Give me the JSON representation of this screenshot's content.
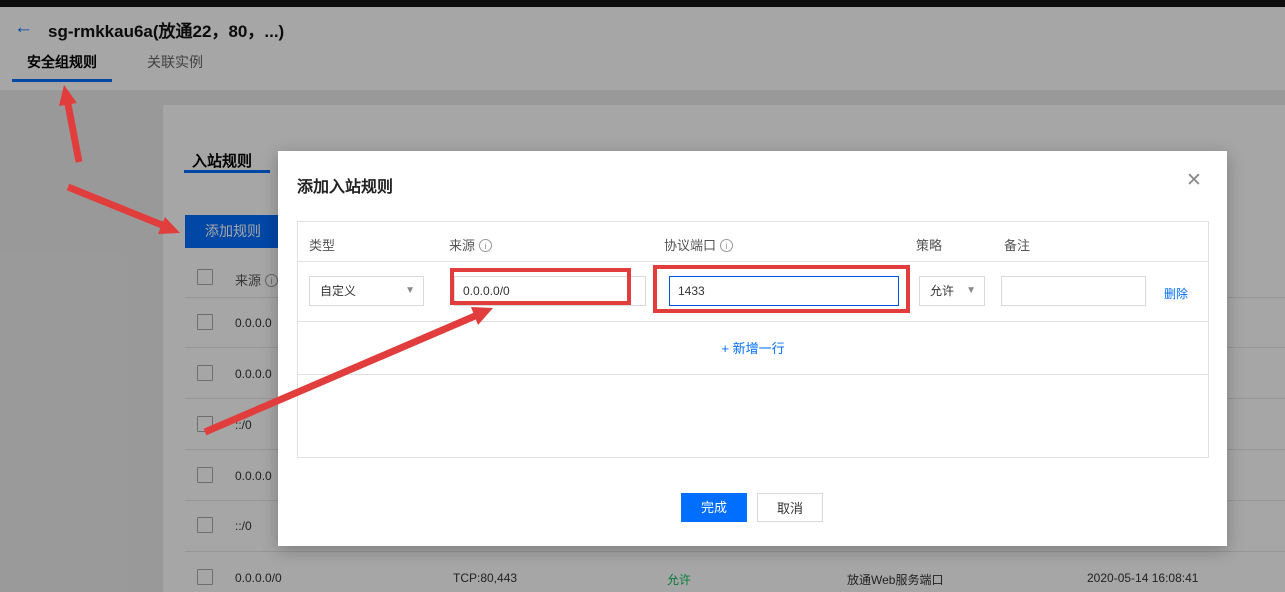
{
  "topbar": {
    "title": "sg-rmkkau6a(放通22，80，...)"
  },
  "tabs": {
    "security_rules": "安全组规则",
    "associated_instances": "关联实例"
  },
  "page": {
    "inbound_tab": "入站规则",
    "add_rule_button": "添加规则",
    "table": {
      "source_header": "来源",
      "rows": [
        "0.0.0.0",
        "0.0.0.0",
        "::/0",
        "0.0.0.0",
        "::/0"
      ],
      "bottom_row": {
        "source": "0.0.0.0/0",
        "protocol_port": "TCP:80,443",
        "policy": "允许",
        "note": "放通Web服务端口",
        "time": "2020-05-14 16:08:41"
      }
    }
  },
  "modal": {
    "title": "添加入站规则",
    "columns": {
      "type": "类型",
      "source": "来源",
      "protocol_port": "协议端口",
      "policy": "策略",
      "note": "备注"
    },
    "row": {
      "type_value": "自定义",
      "source_value": "0.0.0.0/0",
      "port_value": "1433",
      "policy_value": "允许",
      "note_value": "",
      "delete_label": "删除"
    },
    "add_row_label": "+ 新增一行",
    "done_button": "完成",
    "cancel_button": "取消"
  },
  "colors": {
    "accent": "#006eff",
    "annotation": "#e23d3d",
    "allow_green": "#0abf5b"
  }
}
